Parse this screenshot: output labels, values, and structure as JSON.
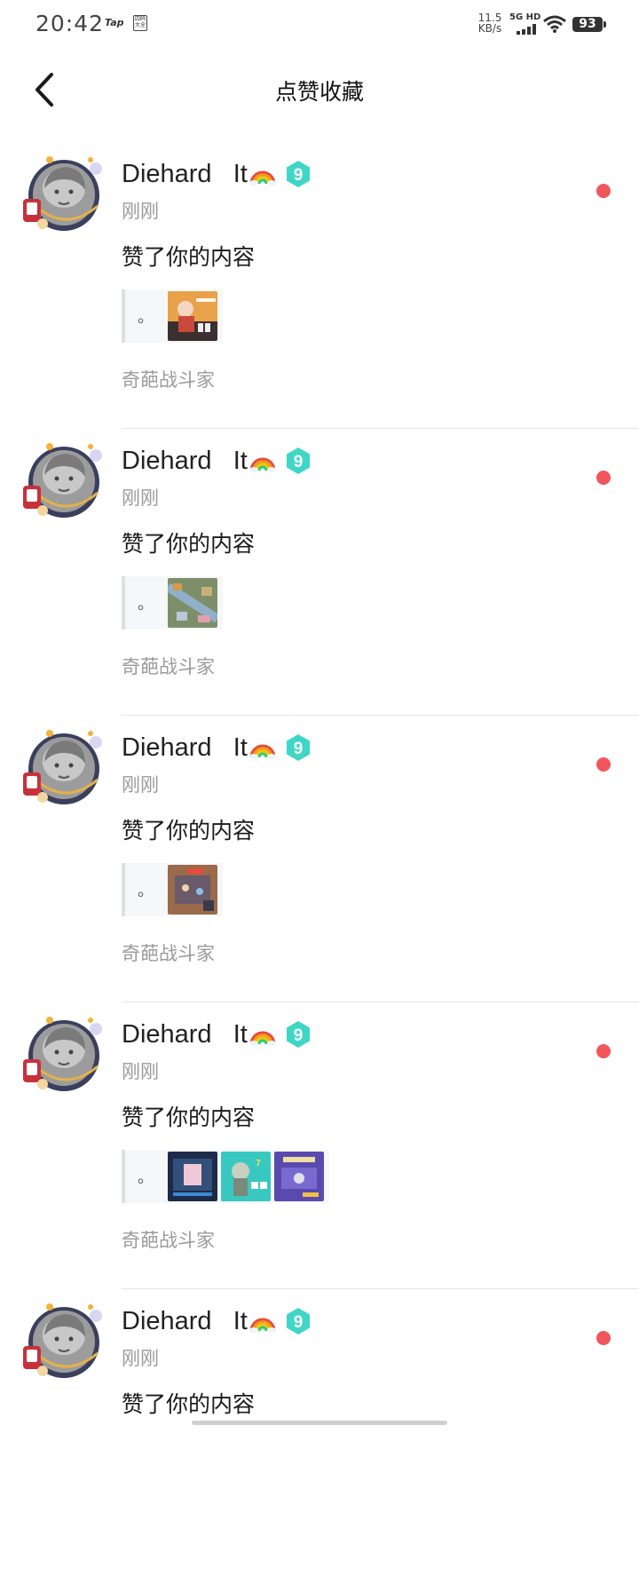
{
  "status_bar": {
    "time": "20:42",
    "tap_logo": "Tap",
    "ime_icon": "四码大全",
    "net_speed_value": "11.5",
    "net_speed_unit": "KB/s",
    "network": "5G HD",
    "battery": "93"
  },
  "header": {
    "title": "点赞收藏"
  },
  "notifications": [
    {
      "user": "Diehard   It",
      "time": "刚刚",
      "action": "赞了你的内容",
      "quote": "。",
      "thumbnails": [
        "orange-game-shot"
      ],
      "game": "奇葩战斗家",
      "unread": true
    },
    {
      "user": "Diehard   It",
      "time": "刚刚",
      "action": "赞了你的内容",
      "quote": "。",
      "thumbnails": [
        "map-game-shot"
      ],
      "game": "奇葩战斗家",
      "unread": true
    },
    {
      "user": "Diehard   It",
      "time": "刚刚",
      "action": "赞了你的内容",
      "quote": "。",
      "thumbnails": [
        "arena-game-shot"
      ],
      "game": "奇葩战斗家",
      "unread": true
    },
    {
      "user": "Diehard   It",
      "time": "刚刚",
      "action": "赞了你的内容",
      "quote": "。",
      "thumbnails": [
        "dark-menu-shot",
        "teal-character-shot",
        "purple-shop-shot"
      ],
      "game": "奇葩战斗家",
      "unread": true
    },
    {
      "user": "Diehard   It",
      "time": "刚刚",
      "action": "赞了你的内容",
      "quote": "",
      "thumbnails": [],
      "game": "",
      "unread": true
    }
  ],
  "colors": {
    "unread_dot": "#f0565c",
    "level_badge": "#3fd6c6",
    "secondary_text": "#9a9a9a"
  }
}
